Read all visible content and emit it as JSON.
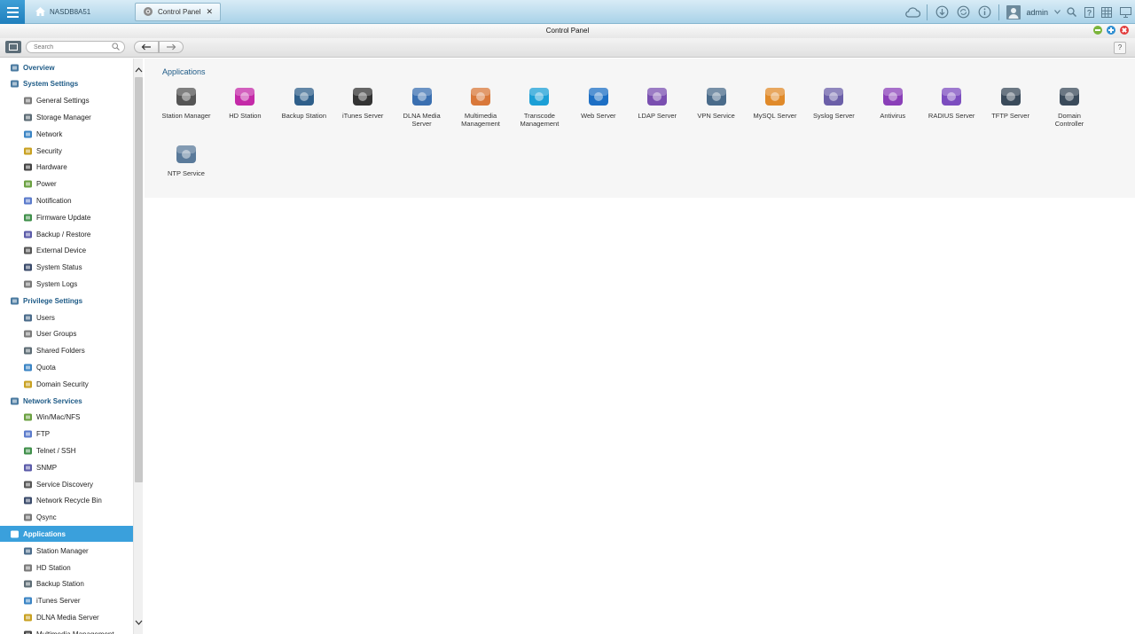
{
  "taskbar": {
    "home_tab_label": "NASDB8A51",
    "control_panel_tab_label": "Control Panel",
    "user_name": "admin"
  },
  "window": {
    "title": "Control Panel"
  },
  "toolbar": {
    "search_placeholder": "Search",
    "help_label": "?"
  },
  "sidebar": {
    "items": [
      {
        "label": "Overview",
        "level": "cat",
        "icon": "overview-icon"
      },
      {
        "label": "System Settings",
        "level": "cat",
        "icon": "gear-icon"
      },
      {
        "label": "General Settings",
        "level": "sub",
        "icon": "general-settings-icon"
      },
      {
        "label": "Storage Manager",
        "level": "sub",
        "icon": "storage-manager-icon"
      },
      {
        "label": "Network",
        "level": "sub",
        "icon": "network-icon"
      },
      {
        "label": "Security",
        "level": "sub",
        "icon": "lock-icon"
      },
      {
        "label": "Hardware",
        "level": "sub",
        "icon": "hardware-icon"
      },
      {
        "label": "Power",
        "level": "sub",
        "icon": "power-icon"
      },
      {
        "label": "Notification",
        "level": "sub",
        "icon": "notification-icon"
      },
      {
        "label": "Firmware Update",
        "level": "sub",
        "icon": "firmware-icon"
      },
      {
        "label": "Backup / Restore",
        "level": "sub",
        "icon": "backup-restore-icon"
      },
      {
        "label": "External Device",
        "level": "sub",
        "icon": "external-device-icon"
      },
      {
        "label": "System Status",
        "level": "sub",
        "icon": "system-status-icon"
      },
      {
        "label": "System Logs",
        "level": "sub",
        "icon": "system-logs-icon"
      },
      {
        "label": "Privilege Settings",
        "level": "cat",
        "icon": "person-icon"
      },
      {
        "label": "Users",
        "level": "sub",
        "icon": "user-icon"
      },
      {
        "label": "User Groups",
        "level": "sub",
        "icon": "user-groups-icon"
      },
      {
        "label": "Shared Folders",
        "level": "sub",
        "icon": "folder-icon"
      },
      {
        "label": "Quota",
        "level": "sub",
        "icon": "quota-icon"
      },
      {
        "label": "Domain Security",
        "level": "sub",
        "icon": "domain-security-icon"
      },
      {
        "label": "Network Services",
        "level": "cat",
        "icon": "globe-icon"
      },
      {
        "label": "Win/Mac/NFS",
        "level": "sub",
        "icon": "win-mac-nfs-icon"
      },
      {
        "label": "FTP",
        "level": "sub",
        "icon": "ftp-icon"
      },
      {
        "label": "Telnet / SSH",
        "level": "sub",
        "icon": "terminal-icon"
      },
      {
        "label": "SNMP",
        "level": "sub",
        "icon": "snmp-icon"
      },
      {
        "label": "Service Discovery",
        "level": "sub",
        "icon": "service-discovery-icon"
      },
      {
        "label": "Network Recycle Bin",
        "level": "sub",
        "icon": "recycle-bin-icon"
      },
      {
        "label": "Qsync",
        "level": "sub",
        "icon": "qsync-icon"
      },
      {
        "label": "Applications",
        "level": "cat",
        "icon": "applications-icon",
        "active": true
      },
      {
        "label": "Station Manager",
        "level": "sub",
        "icon": "station-manager-icon"
      },
      {
        "label": "HD Station",
        "level": "sub",
        "icon": "hd-station-icon"
      },
      {
        "label": "Backup Station",
        "level": "sub",
        "icon": "backup-station-icon"
      },
      {
        "label": "iTunes Server",
        "level": "sub",
        "icon": "itunes-server-icon"
      },
      {
        "label": "DLNA Media Server",
        "level": "sub",
        "icon": "dlna-media-server-icon"
      },
      {
        "label": "Multimedia Management",
        "level": "sub",
        "icon": "multimedia-management-icon"
      }
    ]
  },
  "main": {
    "section_title": "Applications",
    "apps": [
      {
        "label": "Station Manager",
        "icon": "station-manager-icon",
        "color": "#555555"
      },
      {
        "label": "HD Station",
        "icon": "hd-station-icon",
        "color": "#c42aa8"
      },
      {
        "label": "Backup Station",
        "icon": "backup-station-icon",
        "color": "#2f5f8a"
      },
      {
        "label": "iTunes Server",
        "icon": "itunes-server-icon",
        "color": "#333333"
      },
      {
        "label": "DLNA Media Server",
        "icon": "dlna-media-server-icon",
        "color": "#3a6fb0"
      },
      {
        "label": "Multimedia Management",
        "icon": "multimedia-management-icon",
        "color": "#d9783a"
      },
      {
        "label": "Transcode Management",
        "icon": "transcode-management-icon",
        "color": "#1b9fd6"
      },
      {
        "label": "Web Server",
        "icon": "globe-icon",
        "color": "#1d6fc4"
      },
      {
        "label": "LDAP Server",
        "icon": "ldap-server-icon",
        "color": "#7a4fb0"
      },
      {
        "label": "VPN Service",
        "icon": "vpn-service-icon",
        "color": "#4a6b8a"
      },
      {
        "label": "MySQL Server",
        "icon": "mysql-server-icon",
        "color": "#e08a2a"
      },
      {
        "label": "Syslog Server",
        "icon": "syslog-server-icon",
        "color": "#6b5fa8"
      },
      {
        "label": "Antivirus",
        "icon": "antivirus-icon",
        "color": "#8a3fb8"
      },
      {
        "label": "RADIUS Server",
        "icon": "radius-server-icon",
        "color": "#7c4dbf"
      },
      {
        "label": "TFTP Server",
        "icon": "tftp-server-icon",
        "color": "#3a4a5a"
      },
      {
        "label": "Domain Controller",
        "icon": "domain-controller-icon",
        "color": "#3a4a5a"
      },
      {
        "label": "NTP Service",
        "icon": "ntp-service-icon",
        "color": "#5a7a9a"
      }
    ]
  },
  "colors": {
    "accent": "#3aa0dc",
    "category_text": "#1d5a86"
  }
}
